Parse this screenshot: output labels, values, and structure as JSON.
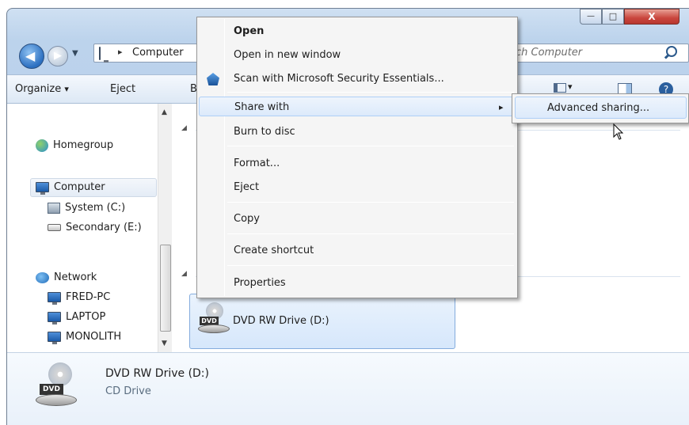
{
  "window": {
    "buttons": {
      "minimize": "—",
      "maximize": "□",
      "close": "X"
    },
    "address": {
      "separator": "▸",
      "text": "Computer"
    },
    "search": {
      "placeholder": "ch Computer"
    }
  },
  "toolbar": {
    "organize_label": "Organize",
    "organize_arrow": "▾",
    "eject_label": "Eject",
    "b_label": "B",
    "view_arrow": "▾"
  },
  "nav": {
    "items": [
      {
        "label": "Homegroup"
      },
      {
        "label": "Computer"
      },
      {
        "label": "System (C:)"
      },
      {
        "label": "Secondary (E:)"
      },
      {
        "label": "Network"
      },
      {
        "label": "FRED-PC"
      },
      {
        "label": "LAPTOP"
      },
      {
        "label": "MONOLITH"
      }
    ]
  },
  "content": {
    "drive_tile_label": "DVD RW Drive (D:)",
    "dvd_badge": "DVD"
  },
  "details": {
    "name": "DVD RW Drive (D:)",
    "type": "CD Drive"
  },
  "context_menu": {
    "items": [
      {
        "label": "Open"
      },
      {
        "label": "Open in new window"
      },
      {
        "label": "Scan with Microsoft Security Essentials..."
      },
      {
        "label": "Share with"
      },
      {
        "label": "Burn to disc"
      },
      {
        "label": "Format..."
      },
      {
        "label": "Eject"
      },
      {
        "label": "Copy"
      },
      {
        "label": "Create shortcut"
      },
      {
        "label": "Properties"
      }
    ],
    "submenu_arrow": "▸",
    "submenu": {
      "label": "Advanced sharing..."
    }
  },
  "colors": {
    "highlight": "#dceafb",
    "accent": "#3a78c8",
    "close": "#c9463d"
  }
}
